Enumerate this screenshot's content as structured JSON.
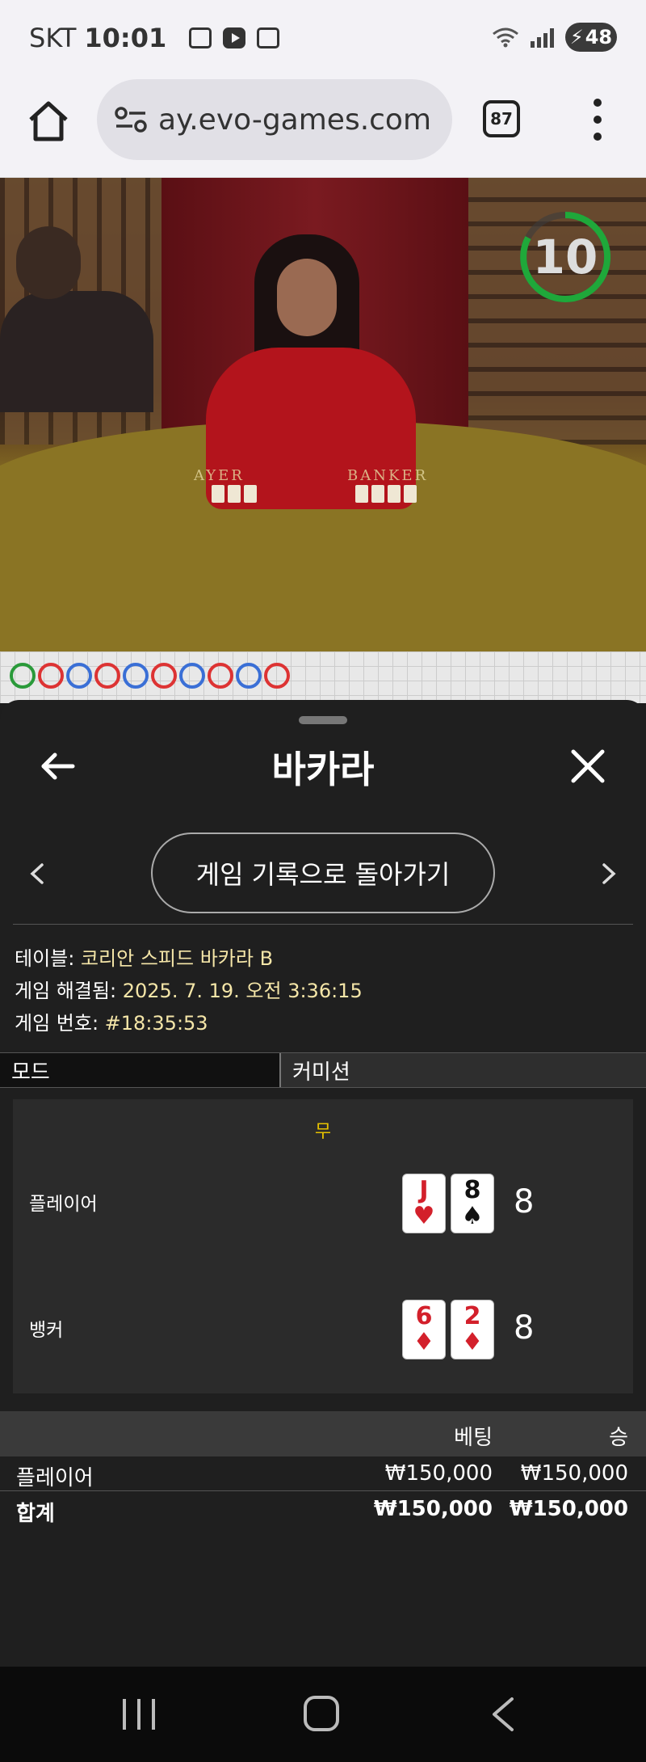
{
  "status_bar": {
    "carrier": "SKT",
    "time": "10:01",
    "battery": "48"
  },
  "browser": {
    "url": "ay.evo-games.com",
    "tab_count": "87"
  },
  "video": {
    "countdown": "10",
    "felt_player": "AYER",
    "felt_banker": "BANKER"
  },
  "road": {
    "beads": [
      "green",
      "red",
      "blue",
      "red",
      "blue",
      "red",
      "blue",
      "red",
      "blue",
      "red"
    ]
  },
  "sheet": {
    "title": "바카라",
    "history_button": "게임 기록으로 돌아가기",
    "table_label": "테이블: ",
    "table_value": "코리안 스피드 바카라 B",
    "resolved_label": "게임 해결됨: ",
    "resolved_value": "2025. 7. 19. 오전 3:36:15",
    "game_no_label": "게임 번호: ",
    "game_no_value": "#18:35:53",
    "tabs": [
      "모드",
      "커미션"
    ],
    "result": {
      "outcome": "무",
      "player_label": "플레이어",
      "banker_label": "뱅커",
      "player_cards": [
        {
          "rank": "J",
          "suit": "♥",
          "color": "red"
        },
        {
          "rank": "8",
          "suit": "♠",
          "color": "black"
        }
      ],
      "banker_cards": [
        {
          "rank": "6",
          "suit": "♦",
          "color": "red"
        },
        {
          "rank": "2",
          "suit": "♦",
          "color": "red"
        }
      ],
      "player_score": "8",
      "banker_score": "8"
    },
    "bets": {
      "header_bet": "베팅",
      "header_win": "승",
      "rows": [
        {
          "label": "플레이어",
          "bet": "₩150,000",
          "win": "₩150,000"
        },
        {
          "label": "합계",
          "bet": "₩150,000",
          "win": "₩150,000"
        }
      ]
    }
  },
  "colors": {
    "accent_yellow": "#e6c200",
    "value_text": "#f5e6a8",
    "timer_green": "#1fa83a"
  }
}
